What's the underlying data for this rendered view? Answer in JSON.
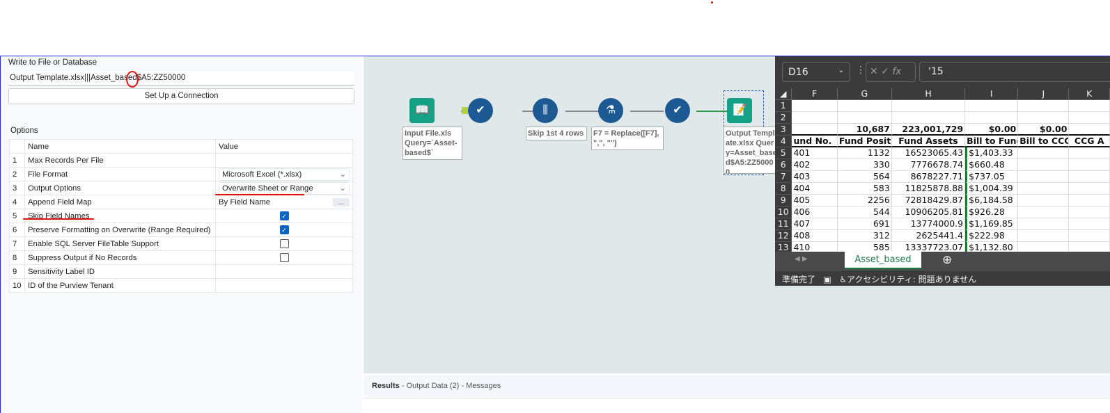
{
  "config": {
    "title": "Write to File or Database",
    "path": "Output Template.xlsx|||Asset_based$A5:ZZ50000",
    "setup_button": "Set Up a Connection",
    "options_label": "Options",
    "headers": [
      "Name",
      "Value"
    ],
    "rows": [
      {
        "n": "1",
        "name": "Max Records Per File",
        "value": ""
      },
      {
        "n": "2",
        "name": "File Format",
        "value": "Microsoft Excel (*.xlsx)"
      },
      {
        "n": "3",
        "name": "Output Options",
        "value": "Overwrite Sheet or Range"
      },
      {
        "n": "4",
        "name": "Append Field Map",
        "value": "By Field Name",
        "button": "..."
      },
      {
        "n": "5",
        "name": "Skip Field Names",
        "checked": true
      },
      {
        "n": "6",
        "name": "Preserve Formatting on Overwrite (Range Required)",
        "checked": true
      },
      {
        "n": "7",
        "name": "Enable SQL Server FileTable Support",
        "checked": false
      },
      {
        "n": "8",
        "name": "Suppress Output if No Records",
        "checked": false
      },
      {
        "n": "9",
        "name": "Sensitivity Label ID",
        "value": ""
      },
      {
        "n": "10",
        "name": "ID of the Purview Tenant",
        "value": ""
      }
    ]
  },
  "workflow": {
    "annotations": {
      "input": "Input File.xls Query=`Asset-based$`",
      "skip": "Skip 1st 4 rows",
      "formula": "F7 = Replace([F7], \",\", \"\")",
      "output": "Output Template.xlsx Query=Asset_based$A5:ZZ50000"
    }
  },
  "results": {
    "title": "Results",
    "subtitle": "- Output Data (2) - Messages"
  },
  "excel": {
    "name_box": "D16",
    "formula": "'15",
    "fx": "fx",
    "columns": [
      "F",
      "G",
      "H",
      "I",
      "J",
      "K"
    ],
    "rows": [
      {
        "n": "1",
        "c": [
          "",
          "",
          "",
          "",
          "",
          ""
        ]
      },
      {
        "n": "2",
        "c": [
          "",
          "",
          "",
          "",
          "",
          ""
        ]
      },
      {
        "n": "3",
        "c": [
          "",
          "10,687",
          "223,001,729",
          "$0.00",
          "$0.00",
          ""
        ]
      },
      {
        "n": "4",
        "c": [
          "und No.",
          "Fund Positions",
          "Fund Assets",
          "Bill to Fund",
          "Bill to CCG",
          "CCG A"
        ]
      },
      {
        "n": "5",
        "c": [
          "401",
          "1132",
          "16523065.43",
          "$1,403.33",
          "",
          ""
        ]
      },
      {
        "n": "6",
        "c": [
          "402",
          "330",
          "7776678.74",
          "$660.48",
          "",
          ""
        ]
      },
      {
        "n": "7",
        "c": [
          "403",
          "564",
          "8678227.71",
          "$737.05",
          "",
          ""
        ]
      },
      {
        "n": "8",
        "c": [
          "404",
          "583",
          "11825878.88",
          "$1,004.39",
          "",
          ""
        ]
      },
      {
        "n": "9",
        "c": [
          "405",
          "2256",
          "72818429.87",
          "$6,184.58",
          "",
          ""
        ]
      },
      {
        "n": "10",
        "c": [
          "406",
          "544",
          "10906205.81",
          "$926.28",
          "",
          ""
        ]
      },
      {
        "n": "11",
        "c": [
          "407",
          "691",
          "13774000.9",
          "$1,169.85",
          "",
          ""
        ]
      },
      {
        "n": "12",
        "c": [
          "408",
          "312",
          "2625441.4",
          "$222.98",
          "",
          ""
        ]
      },
      {
        "n": "13",
        "c": [
          "410",
          "585",
          "13337723.07",
          "$1,132.80",
          "",
          ""
        ]
      }
    ],
    "sheet_tab": "Asset_based",
    "status_ready": "準備完了",
    "accessibility": "アクセシビリティ: 問題ありません"
  }
}
